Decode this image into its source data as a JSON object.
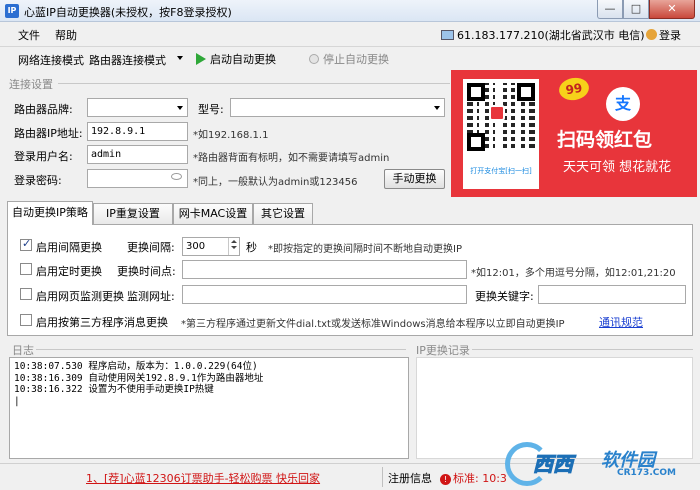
{
  "window": {
    "title": "心蓝IP自动更换器(未授权，按F8登录授权)",
    "app_icon": "IP",
    "min": "—",
    "max": "□",
    "close": "✕"
  },
  "menu": {
    "file": "文件",
    "help": "帮助",
    "ip_info": "61.183.177.210(湖北省武汉市 电信)",
    "login": "登录"
  },
  "toolbar": {
    "mode_label": "网络连接模式",
    "mode_value": "路由器连接模式",
    "start": "启动自动更换",
    "stop": "停止自动更换"
  },
  "connection": {
    "group_title": "连接设置",
    "brand_label": "路由器品牌:",
    "model_label": "型号:",
    "ip_label": "路由器IP地址:",
    "ip_value": "192.8.9.1",
    "ip_hint": "*如192.168.1.1",
    "user_label": "登录用户名:",
    "user_value": "admin",
    "user_hint": "*路由器背面有标明，如不需要请填写admin",
    "pass_label": "登录密码:",
    "pass_hint": "*同上，一般默认为admin或123456",
    "manual_button": "手动更换"
  },
  "ad": {
    "badge": "99",
    "alipay": "支",
    "main": "扫码领红包",
    "sub": "天天可领 想花就花",
    "qr_caption": "打开支付宝[扫一扫]"
  },
  "tabs": [
    "自动更换IP策略",
    "IP重复设置",
    "网卡MAC设置",
    "其它设置"
  ],
  "strategy": {
    "interval_cb": "启用间隔更换",
    "interval_label": "更换间隔:",
    "interval_value": "300",
    "interval_unit": "秒",
    "interval_hint": "*即按指定的更换间隔时间不断地自动更换IP",
    "timed_cb": "启用定时更换",
    "timed_label": "更换时间点:",
    "timed_hint": "*如12:01，多个用逗号分隔，如12:01,21:20",
    "web_cb": "启用网页监测更换",
    "web_url_label": "监测网址:",
    "web_kw_label": "更换关键字:",
    "third_cb": "启用按第三方程序消息更换",
    "third_hint": "*第三方程序通过更新文件dial.txt或发送标准Windows消息给本程序以立即自动更换IP",
    "third_link": "通讯规范"
  },
  "log": {
    "title": "日志",
    "lines": [
      "10:38:07.530 程序启动，版本为：1.0.0.229(64位)",
      "10:38:16.309 自动使用网关192.8.9.1作为路由器地址",
      "10:38:16.322 设置为不使用手动更换IP热键"
    ],
    "cursor": "|"
  },
  "ip_record": {
    "title": "IP更换记录"
  },
  "status": {
    "marquee": "1、[荐]心蓝12306订票助手-轻松购票 快乐回家",
    "reg_label": "注册信息",
    "reg_value": "标准: 10:3",
    "warn": "!"
  },
  "watermark": {
    "text": "西西",
    "brand": "软件园",
    "domain": "CR173.COM"
  },
  "colors": {
    "accent_red": "#e8353b",
    "start_green": "#2fa839",
    "link_blue": "#1a3fd1",
    "warn_red": "#d01515"
  }
}
